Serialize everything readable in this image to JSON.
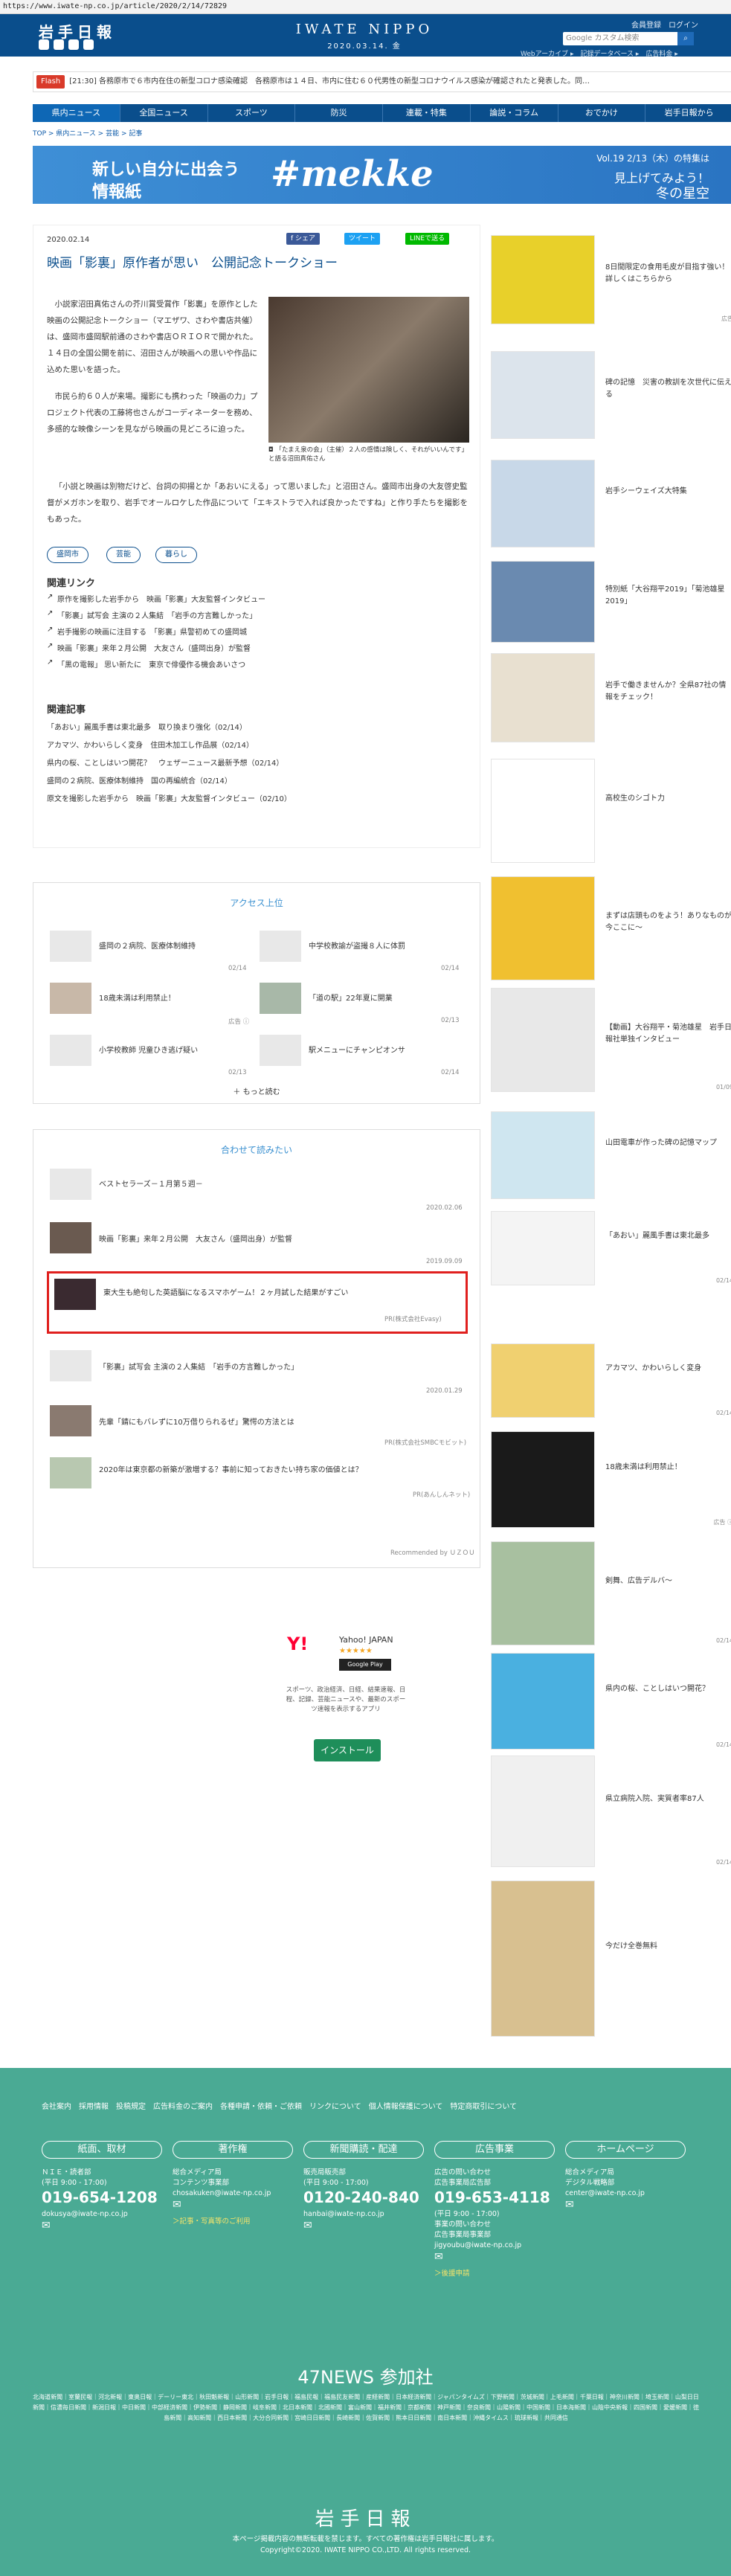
{
  "url": "https://www.iwate-np.co.jp/article/2020/2/14/72829",
  "header": {
    "logo": "岩手日報",
    "masthead": "IWATE NIPPO",
    "date": "2020.03.14. 金",
    "links": "会員登録　ログイン",
    "search_placeholder": "Google カスタム検索",
    "sublinks": "Webアーカイブ ▸　記録データベース ▸　広告料金 ▸"
  },
  "ticker": {
    "flash": "Flash",
    "text": "[21:30] 各務原市で６市内在住の新型コロナ感染確認　各務原市は１４日、市内に住む６０代男性の新型コロナウイルス感染が確認されたと発表した。同…"
  },
  "nav": [
    "県内ニュース",
    "全国ニュース",
    "スポーツ",
    "防災",
    "連載・特集",
    "論説・コラム",
    "おでかけ",
    "岩手日報から"
  ],
  "breadcrumb": "TOP > 県内ニュース > 芸能 > 記事",
  "banner": {
    "l1": "新しい自分に出会う",
    "l2": "情報紙",
    "brand": "#mekke",
    "r1": "Vol.19 2/13（木）の特集は",
    "r2": "見上げてみよう！",
    "r3": "冬の星空"
  },
  "article": {
    "date": "2020.02.14",
    "share": "f シェア",
    "tweet": "ツイート",
    "line": "LINEで送る",
    "title": "映画「影裏」原作者が思い　公開記念トークショー",
    "body": [
      "小説家沼田真佑さんの芥川賞受賞作「影裏」を原作とした映画の公開記念トークショー（マエザワ、さわや書店共催）は、盛岡市盛岡駅前通のさわや書店ＯＲＩＯＲで開かれた。１４日の全国公開を前に、沼田さんが映画への思いや作品に込めた思いを語った。",
      "市民ら約６０人が来場。撮影にも携わった「映画の力」プロジェクト代表の工藤将也さんがコーディネーターを務め、多感的な映像シーンを見ながら映画の見どころに迫った。",
      "「小説と映画は別物だけど、台詞の抑揚とか「あおいにえる」って思いました」と沼田さん。盛岡市出身の大友啓史監督がメガホンを取り、岩手でオールロケした作品について「エキストラで入れば良かったですね」と作り手たちを撮影をもあった。"
    ],
    "caption": "「たまえ泉の会」（主催）２人の感情は険しく、それがいいんです」と語る沼田真佑さん",
    "tags": [
      "盛岡市",
      "芸能",
      "暮らし"
    ],
    "related_links_title": "関連リンク",
    "related_links": [
      "原作を撮影した岩手から　映画「影裏」大友監督インタビュー",
      "「影裏」試写会 主演の２人集結　「岩手の方言難しかった」",
      "岩手撮影の映画に注目する　「影裏」県警初めての盛岡城",
      "映画「影裏」来年２月公開　大友さん（盛岡出身）が監督",
      "「黒の電報」 思い新たに　東京で俳優作る機会あいさつ"
    ],
    "related_news_title": "関連記事",
    "related_news": [
      "「あおい」麗風手書は東北最多　取り換まり強化（02/14）",
      "アカマツ、かわいらしく変身　住田木加工し作品展（02/14）",
      "県内の桜、ことしはいつ開花？　ウェザーニュース最新予想（02/14）",
      "盛岡の２病院、医療体制維持　国の再編統合（02/14）",
      "原文を撮影した岩手から　映画「影裏」大友監督インタビュー（02/10）"
    ]
  },
  "access": {
    "title": "アクセス上位",
    "items": [
      {
        "t": "盛岡の２病院、医療体制維持",
        "d": "02/14"
      },
      {
        "t": "中学校教諭が盗撮８人に体罰",
        "d": "02/14"
      },
      {
        "t": "18歳未満は利用禁止！",
        "d": "広告 ⓘ"
      },
      {
        "t": "「道の駅」22年夏に開業",
        "d": "02/13"
      },
      {
        "t": "小学校教師 児童ひき逃げ疑い",
        "d": "02/13"
      },
      {
        "t": "駅メニューにチャンピオンサ",
        "d": "02/14"
      }
    ],
    "more": "もっと読む"
  },
  "recommend": {
    "title": "合わせて読みたい",
    "items": [
      {
        "t": "ベストセラーズ－１月第５週－",
        "d": "2020.02.06"
      },
      {
        "t": "映画「影裏」来年２月公開　大友さん（盛岡出身）が監督",
        "d": "2019.09.09"
      },
      {
        "t": "東大生も絶句した英語脳になるスマホゲーム！２ヶ月試した結果がすごい",
        "d": "PR(株式会社Evasy)"
      },
      {
        "t": "「影裏」試写会 主演の２人集結　「岩手の方言難しかった」",
        "d": "2020.01.29"
      },
      {
        "t": "先輩「錆にもバレずに10万借りられるぜ」驚愕の方法とは",
        "d": "PR(株式会社SMBCモビット)"
      },
      {
        "t": "2020年は東京都の新築が激増する？事前に知っておきたい持ち家の価値とは？",
        "d": "PR(あんしんネット)"
      }
    ],
    "recommended_by": "Recommended by ＵＺＯＵ"
  },
  "ad": {
    "brand": "Yahoo! JAPAN",
    "stars": "★★★★★",
    "store": "Google Play",
    "desc": "スポーツ、政治経済、日経、結果速報、日程、記録、芸能ニュースや、最新のスポーツ速報を表示するアプリ",
    "btn": "インストール"
  },
  "sidebar": [
    {
      "t": "8日間限定の食用毛皮が目指す強い！詳しくはこちらから",
      "d": "広告"
    },
    {
      "t": "碑の記憶　災害の教訓を次世代に伝える",
      "d": ""
    },
    {
      "t": "岩手シーウェイズ大特集",
      "d": ""
    },
    {
      "t": "特別紙「大谷翔平2019」「菊池雄星2019」",
      "d": ""
    },
    {
      "t": "岩手で働きませんか？全県87社の情報をチェック！",
      "d": ""
    },
    {
      "t": "高校生のシゴト力",
      "d": ""
    },
    {
      "t": "まずは店頭ものをよう！ありなものが今ここに～",
      "d": ""
    },
    {
      "t": "【動画】大谷翔平・菊池雄星　岩手日報社単独インタビュー",
      "d": "01/09"
    },
    {
      "t": "山田電車が作った碑の記憶マップ",
      "d": ""
    },
    {
      "t": "「あおい」麗風手書は東北最多",
      "d": "02/14"
    },
    {
      "t": "アカマツ、かわいらしく変身",
      "d": "02/14"
    },
    {
      "t": "18歳未満は利用禁止！",
      "d": "広告 ⓘ"
    },
    {
      "t": "剣舞、広告デルバ～",
      "d": "02/14"
    },
    {
      "t": "県内の桜、ことしはいつ開花？",
      "d": "02/14"
    },
    {
      "t": "県立病院入院、実質者率87人",
      "d": "02/14"
    },
    {
      "t": "今だけ全巻無料",
      "d": ""
    }
  ],
  "footer": {
    "links": "会社案内　採用情報　投稿規定　広告料金のご案内　各種申請・依頼・ご依頼　リンクについて　個人情報保護について　特定商取引について",
    "cols": [
      {
        "btn": "紙面、取材",
        "l1": "ＮＩＥ・読者部",
        "tel": "019-654-1208",
        "l2": "(平日 9:00 - 17:00)",
        "mail": "dokusya@iwate-np.co.jp"
      },
      {
        "btn": "著作権",
        "l1": "総合メディア局",
        "l2": "コンテンツ事業部",
        "mail": "chosakuken@iwate-np.co.jp",
        "note": "＞記事・写真等のご利用"
      },
      {
        "btn": "新聞購読・配達",
        "l1": "販売局販売部",
        "tel": "0120-240-840",
        "l2": "(平日 9:00 - 17:00)",
        "mail": "hanbai@iwate-np.co.jp"
      },
      {
        "btn": "広告事業",
        "l1": "広告の問い合わせ",
        "l2": "広告事業局広告部",
        "tel": "019-653-4118",
        "l3": "(平日 9:00 - 17:00)",
        "l4": "事業の問い合わせ",
        "l5": "広告事業局事業部",
        "mail": "jigyoubu@iwate-np.co.jp",
        "note": "＞後援申請"
      },
      {
        "btn": "ホームページ",
        "l1": "総合メディア局",
        "l2": "デジタル戦略部",
        "mail": "center@iwate-np.co.jp"
      }
    ],
    "news47": "47NEWS 参加社",
    "partners": "北海道新聞｜室蘭民報｜河北新報｜東奥日報｜デーリー東北｜秋田魁新報｜山形新聞｜岩手日報｜福島民報｜福島民友新聞｜産経新聞｜日本経済新聞｜ジャパンタイムズ｜下野新聞｜茨城新聞｜上毛新聞｜千葉日報｜神奈川新聞｜埼玉新聞｜山梨日日新聞｜信濃毎日新聞｜新潟日報｜中日新聞｜中部経済新聞｜伊勢新聞｜静岡新聞｜岐阜新聞｜北日本新聞｜北國新聞｜富山新聞｜福井新聞｜京都新聞｜神戸新聞｜奈良新聞｜山陽新聞｜中国新聞｜日本海新聞｜山陰中央新報｜四国新聞｜愛媛新聞｜徳島新聞｜高知新聞｜西日本新聞｜大分合同新聞｜宮崎日日新聞｜長崎新聞｜佐賀新聞｜熊本日日新聞｜南日本新聞｜沖縄タイムス｜琉球新報｜共同通信",
    "logo": "岩手日報",
    "copy1": "本ページ掲載内容の無断転載を禁じます。すべての著作権は岩手日報社に属します。",
    "copy2": "Copyright©2020. IWATE NIPPO CO.,LTD. All rights reserved."
  }
}
